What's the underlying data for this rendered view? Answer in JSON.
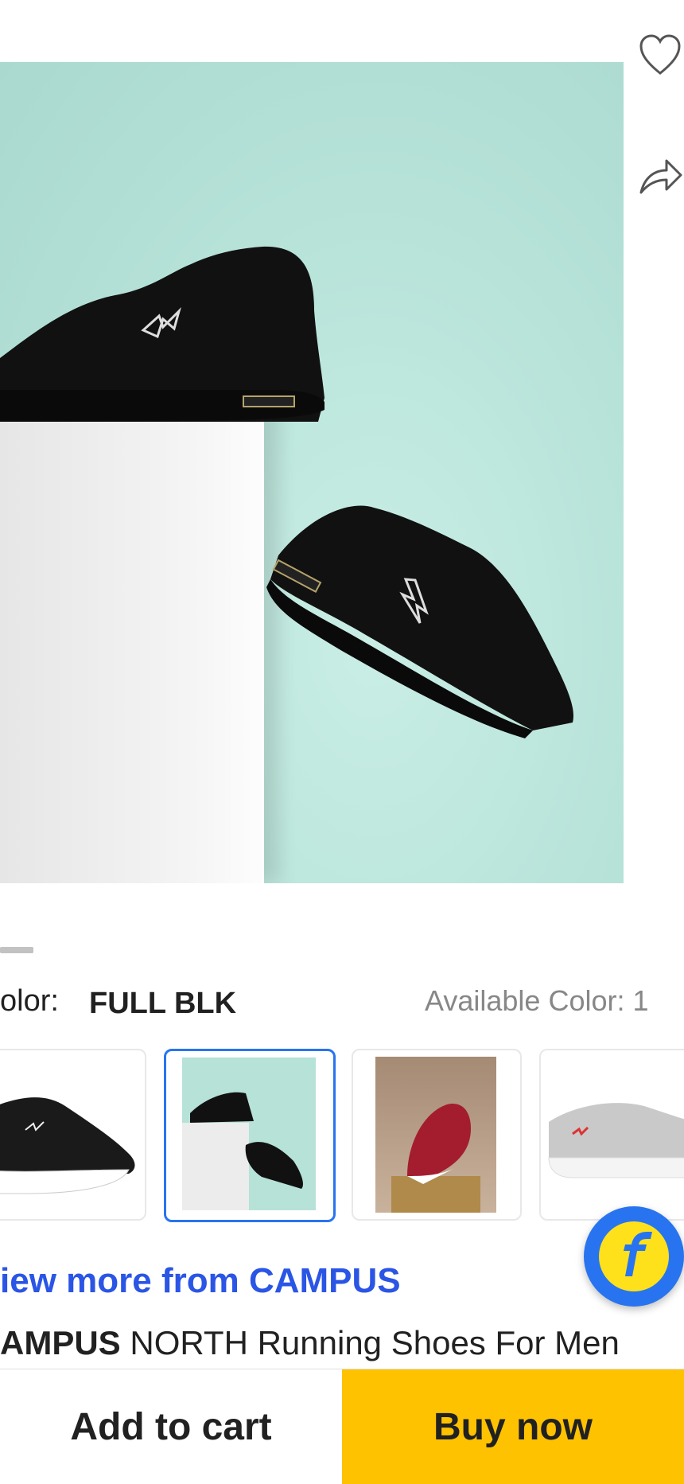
{
  "product": {
    "color_label": "olor:",
    "color_value": "FULL BLK",
    "available_color_label": "Available Color: 1",
    "view_more_link": "iew more from CAMPUS",
    "title_brand": "AMPUS",
    "title_rest": " NORTH Running Shoes For Men"
  },
  "gallery": {
    "thumbnails": [
      {
        "name": "black-white-sole"
      },
      {
        "name": "full-black-pedestal",
        "selected": true
      },
      {
        "name": "red-on-wood"
      },
      {
        "name": "grey"
      }
    ]
  },
  "actions": {
    "add_to_cart": "Add to cart",
    "buy_now": "Buy now"
  },
  "icons": {
    "wishlist": "heart-icon",
    "share": "share-icon",
    "assistant": "flipkart-f-icon"
  },
  "colors": {
    "accent_blue": "#2874f0",
    "buy_now_yellow": "#ffc200",
    "hero_background": "#b6e2d8"
  }
}
